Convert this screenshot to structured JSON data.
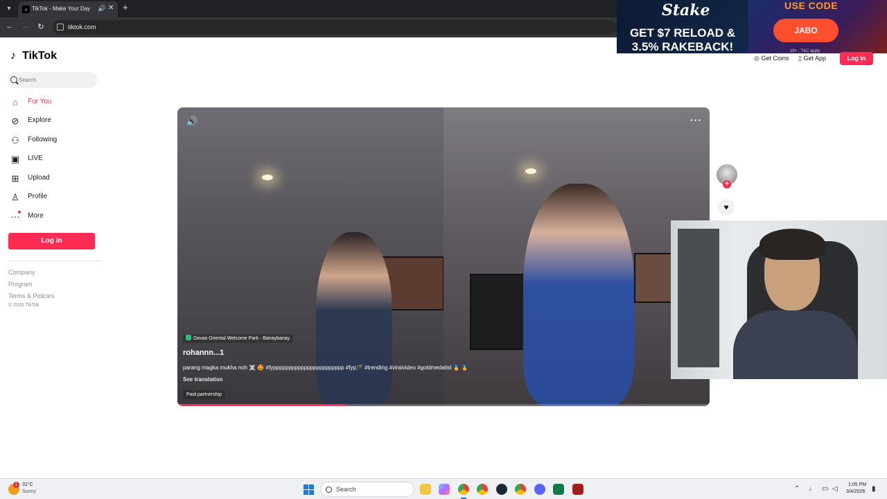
{
  "browser": {
    "tab_title": "TikTok - Make Your Day",
    "url": "tiktok.com"
  },
  "ad": {
    "brand": "Stake",
    "headline": "GET $7 RELOAD & 3.5% RAKEBACK!",
    "use_code": "USE CODE",
    "code": "JABO",
    "fine_print": "18+ · T&C apply"
  },
  "tiktok": {
    "logo": "TikTok",
    "search_placeholder": "Search",
    "nav": [
      {
        "label": "For You",
        "icon": "home-icon",
        "active": true
      },
      {
        "label": "Explore",
        "icon": "compass-icon"
      },
      {
        "label": "Following",
        "icon": "following-icon"
      },
      {
        "label": "LIVE",
        "icon": "live-icon"
      },
      {
        "label": "Upload",
        "icon": "upload-icon"
      },
      {
        "label": "Profile",
        "icon": "profile-icon"
      },
      {
        "label": "More",
        "icon": "more-icon"
      }
    ],
    "login_label": "Log in",
    "footer": {
      "company": "Company",
      "program": "Program",
      "terms": "Terms & Policies",
      "copyright": "© 2026 TikTok"
    },
    "header": {
      "get_coins": "Get Coins",
      "get_app": "Get App",
      "login": "Log in"
    }
  },
  "video": {
    "location": "Davao Oriental Welcome Park - Banaybanay",
    "username": "rohannn...1",
    "caption": "parang magka mukha noh ☠️ 🤩 #fyppppppppppppppppppppppp #fyp🪄 #trending #viralvideo #goldmedalist 🥇 🏅",
    "see_translation": "See translation",
    "paid_label": "Paid partnership",
    "progress_fraction": 0.32
  },
  "taskbar": {
    "temperature": "31°C",
    "weather": "Sunny",
    "search_label": "Search",
    "time": "1:05 PM",
    "date": "3/4/2026"
  },
  "colors": {
    "accent": "#fe2c55",
    "chrome_dark": "#202124"
  }
}
